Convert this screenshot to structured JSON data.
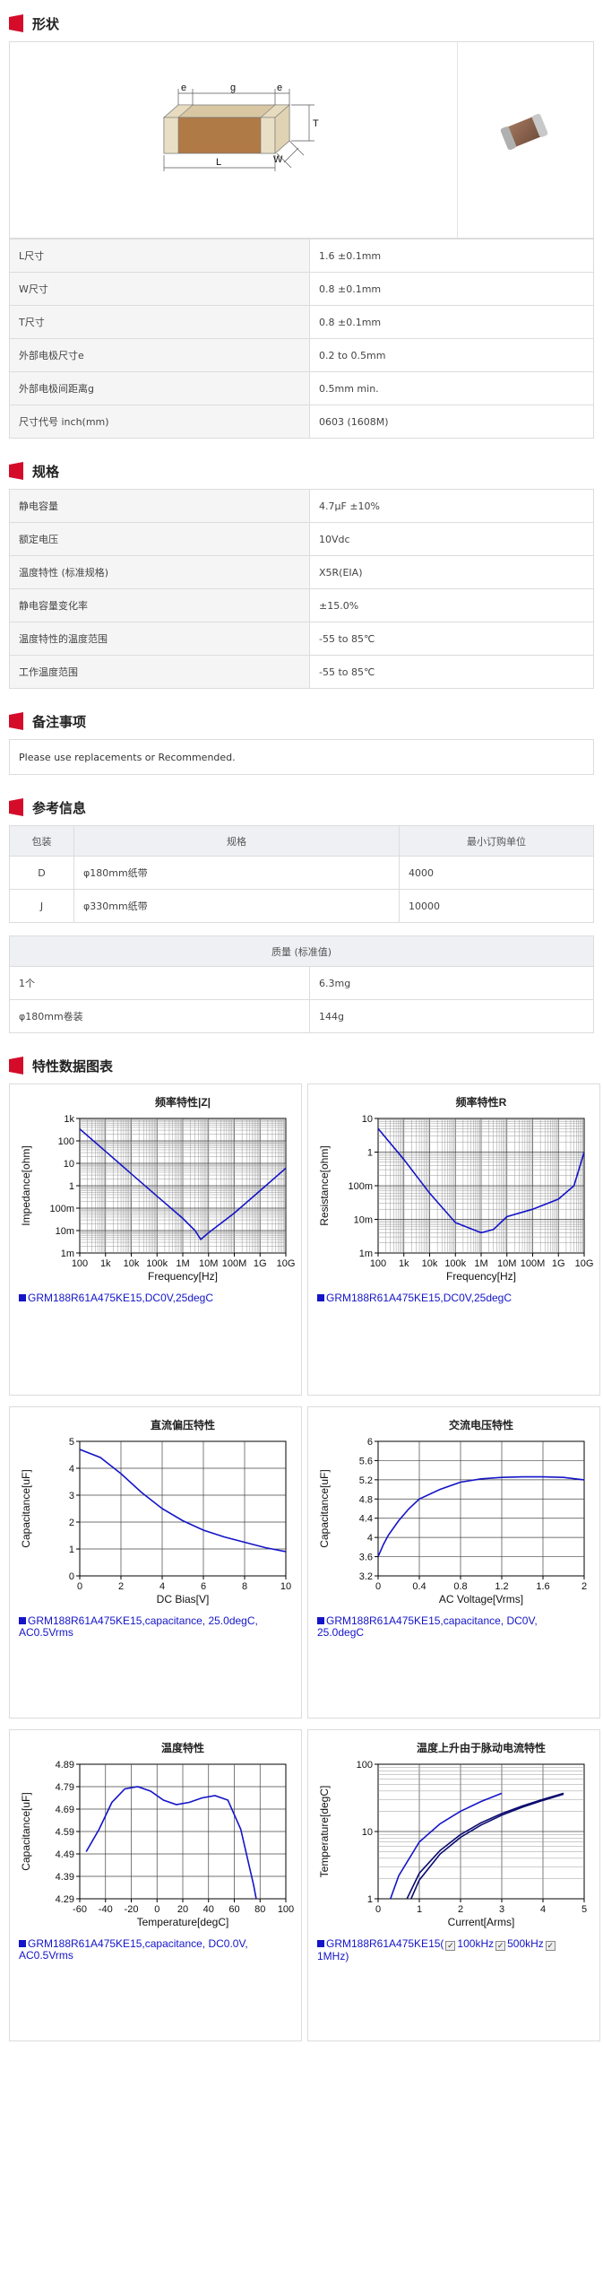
{
  "sections": {
    "shape": "形状",
    "spec": "规格",
    "notes": "备注事项",
    "reference": "参考信息",
    "charts": "特性数据图表"
  },
  "shape_diagram": {
    "label_e1": "e",
    "label_g": "g",
    "label_e2": "e",
    "label_t": "T",
    "label_l": "L",
    "label_w": "W"
  },
  "dimensions": [
    {
      "label": "L尺寸",
      "value": "1.6 ±0.1mm"
    },
    {
      "label": "W尺寸",
      "value": "0.8 ±0.1mm"
    },
    {
      "label": "T尺寸",
      "value": "0.8 ±0.1mm"
    },
    {
      "label": "外部电极尺寸e",
      "value": "0.2 to 0.5mm"
    },
    {
      "label": "外部电极间距离g",
      "value": "0.5mm min."
    },
    {
      "label": "尺寸代号 inch(mm)",
      "value": "0603 (1608M)"
    }
  ],
  "specs": [
    {
      "label": "静电容量",
      "value": "4.7μF ±10%"
    },
    {
      "label": "额定电压",
      "value": "10Vdc"
    },
    {
      "label": "温度特性 (标准规格)",
      "value": "X5R(EIA)"
    },
    {
      "label": "静电容量变化率",
      "value": "±15.0%"
    },
    {
      "label": "温度特性的温度范围",
      "value": "-55 to 85℃"
    },
    {
      "label": "工作温度范围",
      "value": "-55 to 85℃"
    }
  ],
  "notes_text": "Please use replacements or Recommended.",
  "reference_table": {
    "headers": [
      "包装",
      "规格",
      "最小订购单位"
    ],
    "rows": [
      [
        "D",
        "φ180mm纸带",
        "4000"
      ],
      [
        "J",
        "φ330mm纸带",
        "10000"
      ]
    ]
  },
  "mass_table": {
    "header": "质量 (标准值)",
    "rows": [
      [
        "1个",
        "6.3mg"
      ],
      [
        "φ180mm卷装",
        "144g"
      ]
    ]
  },
  "chart_data": [
    {
      "type": "line",
      "title": "频率特性|Z|",
      "xlabel": "Frequency[Hz]",
      "ylabel": "Impedance[ohm]",
      "x_scale": "log",
      "y_scale": "log",
      "xticks": [
        "100",
        "1k",
        "10k",
        "100k",
        "1M",
        "10M",
        "100M",
        "1G",
        "10G"
      ],
      "yticks": [
        "1m",
        "10m",
        "100m",
        "1",
        "10",
        "100",
        "1k"
      ],
      "xlim": [
        100,
        10000000000
      ],
      "ylim": [
        0.001,
        1000
      ],
      "series": [
        {
          "name": "GRM188R61A475KE15,DC0V,25degC",
          "x": [
            100,
            1000,
            10000,
            100000,
            1000000,
            3000000,
            5000000,
            10000000,
            100000000,
            1000000000,
            10000000000
          ],
          "y": [
            340,
            34,
            3.4,
            0.34,
            0.035,
            0.01,
            0.004,
            0.008,
            0.06,
            0.6,
            6
          ]
        }
      ],
      "legend": "GRM188R61A475KE15,DC0V,25degC"
    },
    {
      "type": "line",
      "title": "频率特性R",
      "xlabel": "Frequency[Hz]",
      "ylabel": "Resistance[ohm]",
      "x_scale": "log",
      "y_scale": "log",
      "xticks": [
        "100",
        "1k",
        "10k",
        "100k",
        "1M",
        "10M",
        "100M",
        "1G",
        "10G"
      ],
      "yticks": [
        "1m",
        "10m",
        "100m",
        "1",
        "10"
      ],
      "xlim": [
        100,
        10000000000
      ],
      "ylim": [
        0.001,
        10
      ],
      "series": [
        {
          "name": "GRM188R61A475KE15,DC0V,25degC",
          "x": [
            100,
            1000,
            10000,
            100000,
            1000000,
            3000000,
            10000000,
            100000000,
            1000000000,
            4000000000,
            10000000000
          ],
          "y": [
            5,
            0.6,
            0.06,
            0.008,
            0.004,
            0.005,
            0.012,
            0.02,
            0.04,
            0.1,
            1
          ]
        }
      ],
      "legend": "GRM188R61A475KE15,DC0V,25degC"
    },
    {
      "type": "line",
      "title": "直流偏压特性",
      "xlabel": "DC Bias[V]",
      "ylabel": "Capacitance[uF]",
      "xticks": [
        "0",
        "2",
        "4",
        "6",
        "8",
        "10"
      ],
      "yticks": [
        "0",
        "1",
        "2",
        "3",
        "4",
        "5"
      ],
      "xlim": [
        0,
        10
      ],
      "ylim": [
        0,
        5
      ],
      "series": [
        {
          "name": "GRM188R61A475KE15,capacitance, 25.0degC, AC0.5Vrms",
          "x": [
            0,
            1,
            2,
            3,
            4,
            5,
            6,
            7,
            8,
            9,
            10
          ],
          "y": [
            4.7,
            4.4,
            3.8,
            3.1,
            2.5,
            2.05,
            1.7,
            1.45,
            1.25,
            1.05,
            0.9
          ]
        }
      ],
      "legend": "GRM188R61A475KE15,capacitance, 25.0degC, AC0.5Vrms"
    },
    {
      "type": "line",
      "title": "交流电压特性",
      "xlabel": "AC Voltage[Vrms]",
      "ylabel": "Capacitance[uF]",
      "xticks": [
        "0",
        "0.4",
        "0.8",
        "1.2",
        "1.6",
        "2"
      ],
      "yticks": [
        "3.2",
        "3.6",
        "4",
        "4.4",
        "4.8",
        "5.2",
        "5.6",
        "6"
      ],
      "xlim": [
        0,
        2
      ],
      "ylim": [
        3.2,
        6
      ],
      "series": [
        {
          "name": "GRM188R61A475KE15,capacitance, DC0V, 25.0degC",
          "x": [
            0,
            0.05,
            0.1,
            0.2,
            0.3,
            0.4,
            0.6,
            0.8,
            1.0,
            1.2,
            1.4,
            1.6,
            1.8,
            2.0
          ],
          "y": [
            3.6,
            3.85,
            4.05,
            4.35,
            4.6,
            4.8,
            5.0,
            5.15,
            5.22,
            5.25,
            5.26,
            5.26,
            5.25,
            5.2
          ]
        }
      ],
      "legend": "GRM188R61A475KE15,capacitance, DC0V, 25.0degC"
    },
    {
      "type": "line",
      "title": "温度特性",
      "xlabel": "Temperature[degC]",
      "ylabel": "Capacitance[uF]",
      "xticks": [
        "-60",
        "-40",
        "-20",
        "0",
        "20",
        "40",
        "60",
        "80",
        "100"
      ],
      "yticks": [
        "4.29",
        "4.39",
        "4.49",
        "4.59",
        "4.69",
        "4.79",
        "4.89"
      ],
      "xlim": [
        -60,
        100
      ],
      "ylim": [
        4.29,
        4.89
      ],
      "series": [
        {
          "name": "GRM188R61A475KE15,capacitance, DC0.0V, AC0.5Vrms",
          "x": [
            -55,
            -45,
            -35,
            -25,
            -15,
            -5,
            5,
            15,
            25,
            35,
            45,
            55,
            65,
            75,
            85
          ],
          "y": [
            4.5,
            4.6,
            4.72,
            4.78,
            4.79,
            4.77,
            4.73,
            4.71,
            4.72,
            4.74,
            4.75,
            4.73,
            4.6,
            4.35,
            4.05
          ]
        }
      ],
      "legend": "GRM188R61A475KE15,capacitance, DC0.0V, AC0.5Vrms"
    },
    {
      "type": "line",
      "title": "温度上升由于脉动电流特性",
      "xlabel": "Current[Arms]",
      "ylabel": "Temperature[degC]",
      "y_scale": "log",
      "xticks": [
        "0",
        "1",
        "2",
        "3",
        "4",
        "5"
      ],
      "yticks": [
        "1",
        "10",
        "100"
      ],
      "xlim": [
        0,
        5
      ],
      "ylim": [
        1,
        100
      ],
      "series": [
        {
          "name": "100kHz",
          "x": [
            0.3,
            0.5,
            1.0,
            1.5,
            2.0,
            2.5,
            3.0
          ],
          "y": [
            1,
            2.2,
            7,
            13,
            20,
            28,
            37
          ]
        },
        {
          "name": "500kHz",
          "x": [
            0.7,
            1.0,
            1.5,
            2.0,
            2.5,
            3.0,
            3.5,
            4.0,
            4.5
          ],
          "y": [
            1,
            2.4,
            5.2,
            9,
            13.5,
            18.5,
            24,
            30,
            37
          ]
        },
        {
          "name": "1MHz",
          "x": [
            0.8,
            1.0,
            1.5,
            2.0,
            2.5,
            3.0,
            3.5,
            4.0,
            4.5
          ],
          "y": [
            1,
            1.9,
            4.6,
            8.2,
            12.5,
            17.5,
            23,
            29,
            36
          ]
        }
      ],
      "legend_prefix": "GRM188R61A475KE15(",
      "legend_items": [
        "100kHz",
        "500kHz",
        "1MHz"
      ],
      "legend_suffix": ")"
    }
  ]
}
